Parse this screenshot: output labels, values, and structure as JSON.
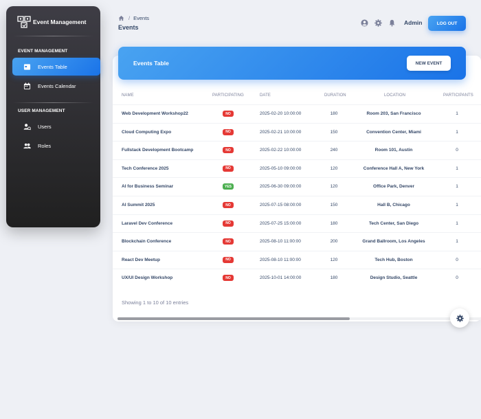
{
  "sidebar": {
    "brand": "Event Management",
    "sections": [
      {
        "title": "EVENT MANAGEMENT"
      },
      {
        "title": "USER MANAGEMENT"
      }
    ],
    "items": [
      {
        "label": "Events Table",
        "icon": "table-icon",
        "active": true
      },
      {
        "label": "Events Calendar",
        "icon": "calendar-icon",
        "active": false
      },
      {
        "label": "Users",
        "icon": "user-plus-icon",
        "active": false
      },
      {
        "label": "Roles",
        "icon": "group-icon",
        "active": false
      }
    ]
  },
  "breadcrumb": {
    "current": "Events"
  },
  "page_title": "Events",
  "topbar": {
    "user": "Admin",
    "logout_label": "LOG OUT"
  },
  "card": {
    "title": "Events Table",
    "new_event_label": "NEW EVENT",
    "columns": [
      "NAME",
      "PARTICIPATING",
      "DATE",
      "DURATION",
      "LOCATION",
      "PARTICIPANTS"
    ],
    "rows": [
      {
        "name": "Web Development Workshop22",
        "participating": "NO",
        "date": "2025-02-20 10:00:00",
        "duration": "180",
        "location": "Room 203, San Francisco",
        "participants": "1"
      },
      {
        "name": "Cloud Computing Expo",
        "participating": "NO",
        "date": "2025-02-21 10:00:00",
        "duration": "150",
        "location": "Convention Center, Miami",
        "participants": "1"
      },
      {
        "name": "Fullstack Development Bootcamp",
        "participating": "NO",
        "date": "2025-02-22 10:00:00",
        "duration": "240",
        "location": "Room 101, Austin",
        "participants": "0"
      },
      {
        "name": "Tech Conference 2025",
        "participating": "NO",
        "date": "2025-05-10 09:00:00",
        "duration": "120",
        "location": "Conference Hall A, New York",
        "participants": "1"
      },
      {
        "name": "AI for Business Seminar",
        "participating": "YES",
        "date": "2025-06-30 09:00:00",
        "duration": "120",
        "location": "Office Park, Denver",
        "participants": "1"
      },
      {
        "name": "AI Summit 2025",
        "participating": "NO",
        "date": "2025-07-15 08:00:00",
        "duration": "150",
        "location": "Hall B, Chicago",
        "participants": "1"
      },
      {
        "name": "Laravel Dev Conference",
        "participating": "NO",
        "date": "2025-07-25 15:00:00",
        "duration": "180",
        "location": "Tech Center, San Diego",
        "participants": "1"
      },
      {
        "name": "Blockchain Conference",
        "participating": "NO",
        "date": "2025-08-10 11:00:00",
        "duration": "200",
        "location": "Grand Ballroom, Los Angeles",
        "participants": "1"
      },
      {
        "name": "React Dev Meetup",
        "participating": "NO",
        "date": "2025-08-10 11:00:00",
        "duration": "120",
        "location": "Tech Hub, Boston",
        "participants": "0"
      },
      {
        "name": "UX/UI Design Workshop",
        "participating": "NO",
        "date": "2025-10-01 14:00:00",
        "duration": "180",
        "location": "Design Studio, Seattle",
        "participants": "0"
      }
    ],
    "entries_text": "Showing 1 to 10 of 10 entries"
  },
  "colors": {
    "accent": "#1a73e8",
    "no": "#e53935",
    "yes": "#4caf50"
  }
}
